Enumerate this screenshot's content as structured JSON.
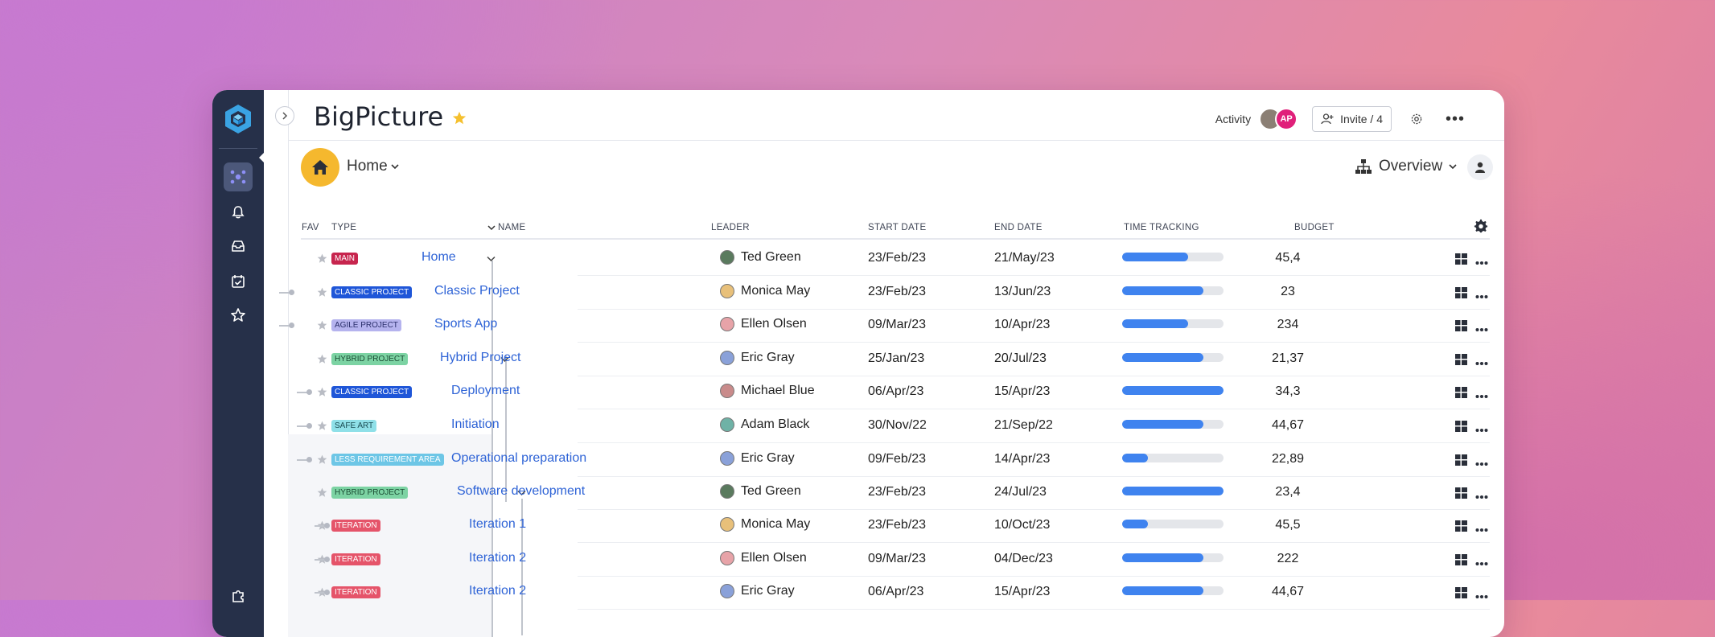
{
  "app": {
    "title": "BigPicture",
    "activity_label": "Activity",
    "avatar_initials": "AP",
    "invite_label": "Invite / 4",
    "home_label": "Home",
    "view_label": "Overview"
  },
  "colors": {
    "sidebar_bg": "#263049",
    "accent_blue": "#2e63d6",
    "progress": "#3f83ef",
    "home_yellow": "#f5b82e"
  },
  "columns": {
    "fav": "FAV",
    "type": "TYPE",
    "name": "NAME",
    "leader": "LEADER",
    "start": "START DATE",
    "end": "END DATE",
    "time": "TIME TRACKING",
    "budget": "BUDGET"
  },
  "rows": [
    {
      "type": "MAIN",
      "type_color": "#c7254e",
      "name": "Home",
      "leader": "Ted Green",
      "start": "23/Feb/23",
      "end": "21/May/23",
      "progress": 0.65,
      "budget": "45,4"
    },
    {
      "type": "CLASSIC PROJECT",
      "type_color": "#1f56d8",
      "name": "Classic Project",
      "leader": "Monica May",
      "start": "23/Feb/23",
      "end": "13/Jun/23",
      "progress": 0.8,
      "budget": "23"
    },
    {
      "type": "AGILE PROJECT",
      "type_color": "#b5b3ee",
      "name": "Sports App",
      "leader": "Ellen Olsen",
      "start": "09/Mar/23",
      "end": "10/Apr/23",
      "progress": 0.65,
      "budget": "234"
    },
    {
      "type": "HYBRID PROJECT",
      "type_color": "#7cd3a3",
      "name": "Hybrid Project",
      "leader": "Eric Gray",
      "start": "25/Jan/23",
      "end": "20/Jul/23",
      "progress": 0.8,
      "budget": "21,37"
    },
    {
      "type": "CLASSIC PROJECT",
      "type_color": "#1f56d8",
      "name": "Deployment",
      "leader": "Michael Blue",
      "start": "06/Apr/23",
      "end": "15/Apr/23",
      "progress": 1.0,
      "budget": "34,3"
    },
    {
      "type": "SAFe ART",
      "type_color": "#8fe0e8",
      "name": "Initiation",
      "leader": "Adam Black",
      "start": "30/Nov/22",
      "end": "21/Sep/22",
      "progress": 0.8,
      "budget": "44,67"
    },
    {
      "type": "LESS REQUIREMENT AREA",
      "type_color": "#6dc6e6",
      "name": "Operational preparation",
      "leader": "Eric Gray",
      "start": "09/Feb/23",
      "end": "14/Apr/23",
      "progress": 0.25,
      "budget": "22,89"
    },
    {
      "type": "HYBRID PROJECT",
      "type_color": "#7cd3a3",
      "name": "Software development",
      "leader": "Ted Green",
      "start": "23/Feb/23",
      "end": "24/Jul/23",
      "progress": 1.0,
      "budget": "23,4"
    },
    {
      "type": "ITERATION",
      "type_color": "#e5546a",
      "name": "Iteration 1",
      "leader": "Monica May",
      "start": "23/Feb/23",
      "end": "10/Oct/23",
      "progress": 0.25,
      "budget": "45,5"
    },
    {
      "type": "ITERATION",
      "type_color": "#e5546a",
      "name": "Iteration 2",
      "leader": "Ellen Olsen",
      "start": "09/Mar/23",
      "end": "04/Dec/23",
      "progress": 0.8,
      "budget": "222"
    },
    {
      "type": "ITERATION",
      "type_color": "#e5546a",
      "name": "Iteration 2",
      "leader": "Eric Gray",
      "start": "06/Apr/23",
      "end": "15/Apr/23",
      "progress": 0.8,
      "budget": "44,67"
    }
  ]
}
